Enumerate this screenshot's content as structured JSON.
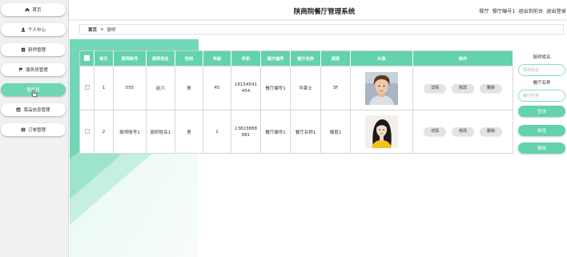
{
  "app": {
    "title": "陕商院餐厅管理系统"
  },
  "header": {
    "user_role": "餐厅",
    "user_name": "餐厅编号1",
    "back_to_front": "退出到前台",
    "logout": "退出登录"
  },
  "sidebar": {
    "items": [
      {
        "label": "首页",
        "icon": "home-icon"
      },
      {
        "label": "个人中心",
        "icon": "user-icon"
      },
      {
        "label": "厨师管理",
        "icon": "clipboard-check-icon"
      },
      {
        "label": "服务员管理",
        "icon": "flag-icon"
      },
      {
        "label": "服务员",
        "icon": "",
        "active": true
      },
      {
        "label": "菜品信息管理",
        "icon": "bar-chart-icon"
      },
      {
        "label": "订单管理",
        "icon": "list-icon"
      }
    ]
  },
  "breadcrumb": {
    "home": "首页",
    "separator": "≡",
    "current": "厨师"
  },
  "table": {
    "columns": [
      "索引",
      "厨师账号",
      "厨师姓名",
      "性别",
      "年龄",
      "手机",
      "餐厅编号",
      "餐厅名称",
      "楼层",
      "头像",
      "操作"
    ],
    "rows": [
      {
        "index": "1",
        "account": "555",
        "name": "赵六",
        "gender": "男",
        "age": "45",
        "phone": "18154541454",
        "restaurant_no": "餐厅编号1",
        "restaurant_name": "华莱士",
        "floor": "3F"
      },
      {
        "index": "2",
        "account": "厨师账号1",
        "name": "厨师姓名1",
        "gender": "男",
        "age": "1",
        "phone": "13823888881",
        "restaurant_no": "餐厅编号1",
        "restaurant_name": "餐厅名称1",
        "floor": "楼层1"
      }
    ],
    "actions": {
      "detail": "详情",
      "edit": "修改",
      "delete": "删除"
    }
  },
  "search": {
    "name_label": "厨师姓名",
    "name_placeholder": "厨师姓名",
    "name_value": "",
    "restaurant_label": "餐厅名称",
    "restaurant_placeholder": "餐厅名称",
    "restaurant_value": "",
    "query_button": "查询",
    "add_button": "新增",
    "delete_button": "删除"
  },
  "colors": {
    "accent": "#63d2ae",
    "sidebar_bg": "#f1f1f1",
    "action_button_bg": "#e3e3e3"
  }
}
